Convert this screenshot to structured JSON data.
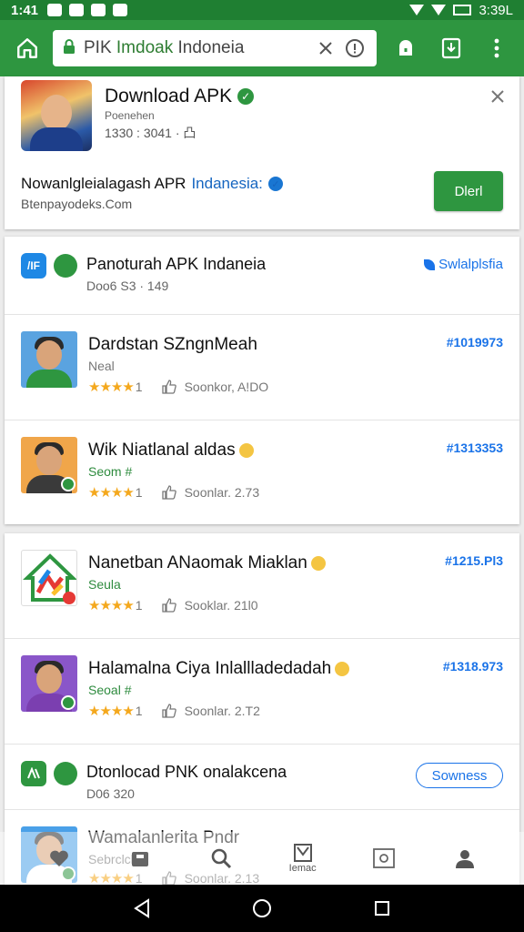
{
  "status_bar": {
    "time": "1:41",
    "clock_right": "3:39L"
  },
  "browser": {
    "url_prefix": "PIK",
    "url_highlight": "Imdoak",
    "url_suffix": "Indoneia"
  },
  "hero": {
    "title": "Download APK",
    "subtitle": "Poenehen",
    "meta": "1330 : 3041 · 凸",
    "desc_prefix": "Nowanlgleialagash APR",
    "desc_highlight": "Indanesia:",
    "site": "Btenpayodeks.Com",
    "open_label": "Dlerl"
  },
  "section1": {
    "icon_label": "/IF",
    "title": "Panoturah APK Indaneia",
    "meta": "Doo6 S3 · 149",
    "link": "Swlalplsfia",
    "apps": [
      {
        "name": "Dardstan SZngnMeah",
        "dev": "Neal",
        "rating": "1",
        "likes": "Soonkor, A!DO",
        "size": "#1019973",
        "shirt": "#2e9640",
        "bg": "#5aa3e0",
        "emoji": false,
        "badge": false
      },
      {
        "name": "Wik Niatlanal aldas",
        "dev": "Seom #",
        "rating": "1",
        "likes": "Soonlar. 2.73",
        "size": "#1313353",
        "shirt": "#3a3a3a",
        "bg": "#f0a64a",
        "emoji": true,
        "badge": true
      }
    ]
  },
  "section2": {
    "apps": [
      {
        "name": "Nanetban ANaomak Miaklan",
        "dev": "Seula",
        "rating": "1",
        "likes": "Sooklar. 21l0",
        "size": "#1215.Pl3",
        "shirt": "",
        "bg": "",
        "emoji": true,
        "badge": false
      },
      {
        "name": "Halamalna Ciya Inlallladedadah",
        "dev": "Seoal #",
        "rating": "1",
        "likes": "Soonlar. 2.T2",
        "size": "#1318.973",
        "shirt": "#7b3fb0",
        "bg": "#8a56c9",
        "emoji": true,
        "badge": true
      }
    ],
    "download_row": {
      "title": "Dtonlocad PNK onalakcena",
      "meta": "D06 320",
      "button": "Sowness"
    },
    "partial_app": {
      "name": "Wamalanlerita Pndr",
      "dev": "Sebrclcles",
      "rating": "1",
      "likes": "Soonlar. 2.13"
    }
  },
  "bottom_nav": {
    "label": "Iemac"
  },
  "colors": {
    "brand": "#2e9640",
    "status_bar": "#1f7f32",
    "link": "#1a73e8",
    "star": "#f4a81d"
  }
}
